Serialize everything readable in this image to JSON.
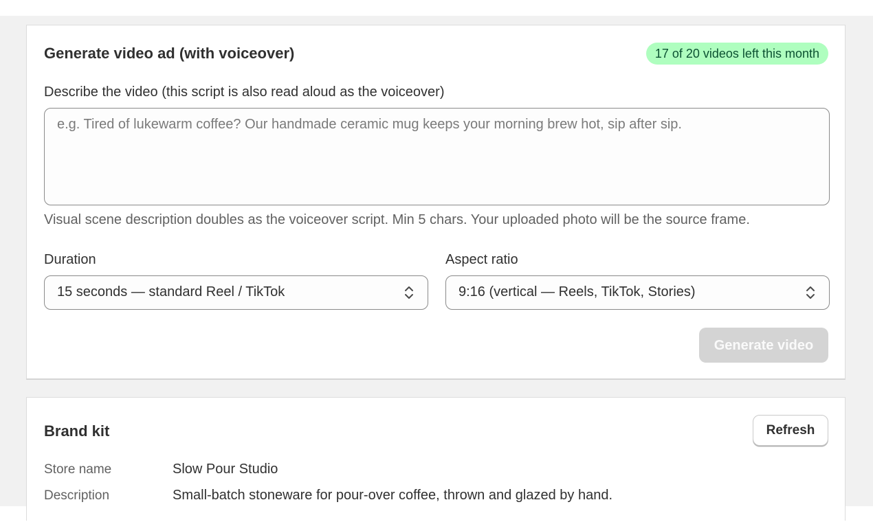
{
  "video_card": {
    "title": "Generate video ad (with voiceover)",
    "quota_badge": "17 of 20 videos left this month",
    "description_label": "Describe the video (this script is also read aloud as the voiceover)",
    "description_value": "",
    "description_placeholder": "e.g. Tired of lukewarm coffee? Our handmade ceramic mug keeps your morning brew hot, sip after sip.",
    "help_text": "Visual scene description doubles as the voiceover script. Min 5 chars. Your uploaded photo will be the source frame.",
    "duration_label": "Duration",
    "duration_value": "15 seconds — standard Reel / TikTok",
    "aspect_label": "Aspect ratio",
    "aspect_value": "9:16 (vertical — Reels, TikTok, Stories)",
    "generate_button": "Generate video",
    "generate_disabled": true
  },
  "brand_card": {
    "title": "Brand kit",
    "refresh_button": "Refresh",
    "rows": [
      {
        "key": "Store name",
        "value": "Slow Pour Studio"
      },
      {
        "key": "Description",
        "value": "Small-batch stoneware for pour-over coffee, thrown and glazed by hand."
      }
    ]
  },
  "colors": {
    "badge_bg": "#affebf",
    "badge_text": "#0c5132",
    "disabled_button": "#d4d4d4",
    "page_background": "#f1f1f1"
  },
  "icons": [
    "select-chevron-icon"
  ]
}
